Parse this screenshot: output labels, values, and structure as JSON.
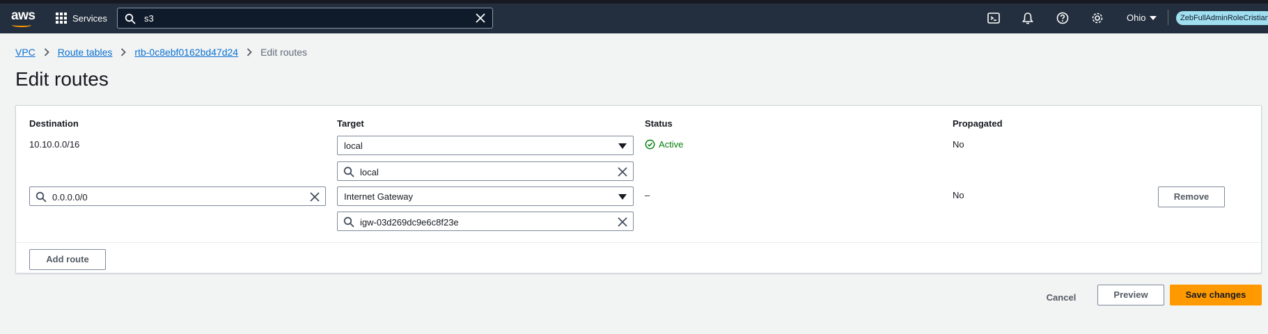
{
  "header": {
    "logo_text": "aws",
    "services_label": "Services",
    "search_value": "s3",
    "region": "Ohio",
    "role": "ZebFullAdminRoleCristian"
  },
  "breadcrumb": {
    "items": [
      "VPC",
      "Route tables",
      "rtb-0c8ebf0162bd47d24"
    ],
    "current": "Edit routes"
  },
  "page_title": "Edit routes",
  "table": {
    "columns": [
      "Destination",
      "Target",
      "Status",
      "Propagated"
    ],
    "rows": [
      {
        "destination": "10.10.0.0/16",
        "target_type": "local",
        "target_filter": "local",
        "status": "Active",
        "propagated": "No"
      },
      {
        "destination": "0.0.0.0/0",
        "target_type": "Internet Gateway",
        "target_filter": "igw-03d269dc9e6c8f23e",
        "status": "–",
        "propagated": "No",
        "remove_label": "Remove"
      }
    ],
    "add_route_label": "Add route"
  },
  "footer": {
    "cancel_label": "Cancel",
    "preview_label": "Preview",
    "save_label": "Save changes"
  },
  "colors": {
    "header_bg": "#232f3e",
    "link": "#0972d3",
    "primary_button": "#ff9900",
    "status_ok": "#037f0c",
    "region_badge": "#a0dff0"
  }
}
